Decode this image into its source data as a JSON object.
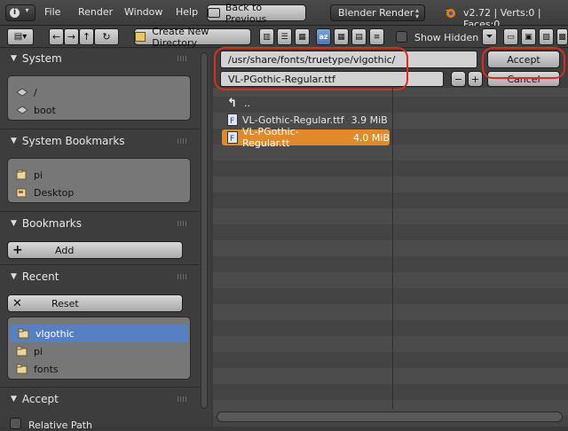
{
  "header": {
    "menus": [
      "File",
      "Render",
      "Window",
      "Help"
    ],
    "back_button": "Back to Previous",
    "engine": "Blender Render",
    "stats": "v2.72 | Verts:0 | Faces:0"
  },
  "toolbar": {
    "create_dir": "Create New Directory",
    "show_hidden": "Show Hidden"
  },
  "path": {
    "directory": "/usr/share/fonts/truetype/vlgothic/",
    "filename": "VL-PGothic-Regular.ttf",
    "accept": "Accept",
    "cancel": "Cancel",
    "minus": "−",
    "plus": "+"
  },
  "sidebar": {
    "system": {
      "title": "System",
      "items": [
        "/",
        "boot"
      ]
    },
    "system_bookmarks": {
      "title": "System Bookmarks",
      "items": [
        "pi",
        "Desktop"
      ]
    },
    "bookmarks": {
      "title": "Bookmarks",
      "add": "Add"
    },
    "recent": {
      "title": "Recent",
      "reset": "Reset",
      "items": [
        "vlgothic",
        "pi",
        "fonts"
      ]
    },
    "accept": {
      "title": "Accept",
      "relative_path": "Relative Path"
    }
  },
  "files": {
    "parent": "..",
    "items": [
      {
        "name": "VL-Gothic-Regular.ttf",
        "size": "3.9 MiB"
      },
      {
        "name": "VL-PGothic-Regular.tt",
        "size": "4.0 MiB"
      }
    ]
  },
  "colors": {
    "selected_file": "#e08a2a",
    "selected_recent": "#5680c2",
    "highlight": "#e02a1a"
  }
}
